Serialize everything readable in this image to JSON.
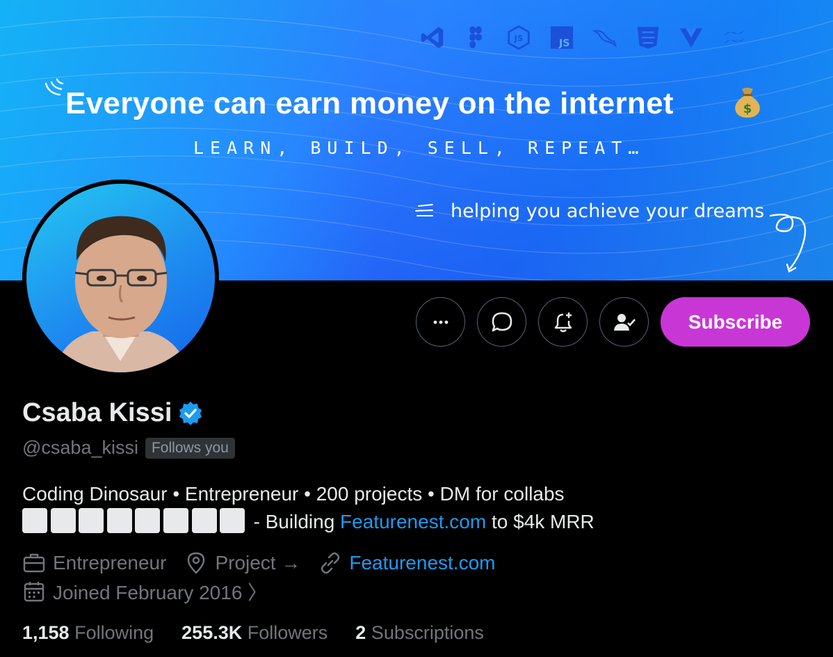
{
  "banner": {
    "headline": "Everyone can earn money on the internet",
    "tagline": "LEARN, BUILD, SELL, REPEAT…",
    "helping": "helping you achieve your dreams",
    "tech_icons": [
      "vscode-icon",
      "figma-icon",
      "nodejs-icon",
      "javascript-icon",
      "mysql-icon",
      "html-css-icon",
      "vue-icon",
      "tailwind-icon"
    ],
    "js_label": "JS",
    "colors": {
      "start": "#1f9bf0",
      "end": "#2a4fe0"
    }
  },
  "profile": {
    "name": "Csaba Kissi",
    "handle": "@csaba_kissi",
    "follows_badge": "Follows you",
    "bio_line1": "Coding Dinosaur • Entrepreneur • 200 projects • DM for collabs",
    "bio_line2_prefix": "- Building",
    "bio_link": "Featurenest.com",
    "bio_line2_suffix": "to $4k MRR",
    "category": "Entrepreneur",
    "location": "Project →",
    "website": "Featurenest.com",
    "joined": "Joined February 2016 〉"
  },
  "actions": {
    "subscribe_label": "Subscribe",
    "subscribe_color": "#c936d6"
  },
  "stats": {
    "following_count": "1,158",
    "following_label": "Following",
    "followers_count": "255.3K",
    "followers_label": "Followers",
    "subscriptions_count": "2",
    "subscriptions_label": "Subscriptions"
  }
}
